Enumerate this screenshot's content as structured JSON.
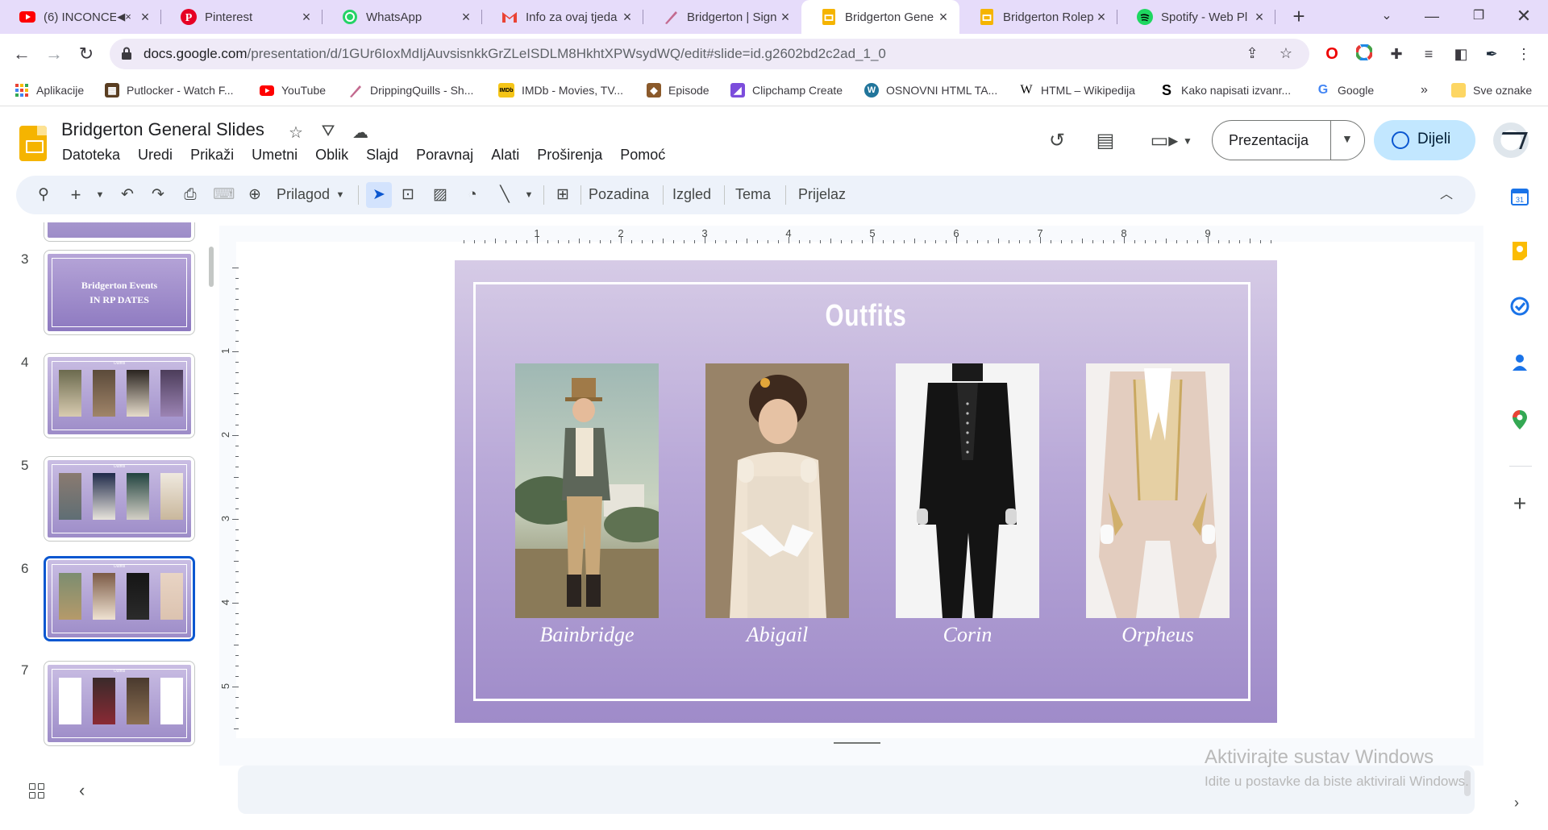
{
  "browser": {
    "tabs": [
      {
        "label": "(6) INCONCE",
        "icon": "youtube-icon",
        "color": "#ff0000",
        "muted_icon": true
      },
      {
        "label": "Pinterest",
        "icon": "pinterest-icon",
        "color": "#e60023"
      },
      {
        "label": "WhatsApp",
        "icon": "whatsapp-icon",
        "color": "#25d366"
      },
      {
        "label": "Info za ovaj tjeda",
        "icon": "gmail-icon",
        "color": "#ea4335"
      },
      {
        "label": "Bridgerton | Sign",
        "icon": "quill-icon",
        "color": "#c36a8f"
      },
      {
        "label": "Bridgerton Gene",
        "icon": "slides-icon",
        "color": "#f5b400",
        "active": true
      },
      {
        "label": "Bridgerton Rolep",
        "icon": "slides-icon",
        "color": "#f5b400"
      },
      {
        "label": "Spotify - Web Pl",
        "icon": "spotify-icon",
        "color": "#1ed760"
      }
    ],
    "url_main": "docs.google.com",
    "url_rest": "/presentation/d/1GUr6IoxMdIjAuvsisnkkGrZLeISDLM8HkhtXPWsydWQ/edit#slide=id.g2602bd2c2ad_1_0",
    "bookmarks": [
      {
        "label": "Aplikacije",
        "icon": "apps-grid-icon"
      },
      {
        "label": "Putlocker - Watch F...",
        "icon": "putlocker-icon"
      },
      {
        "label": "YouTube",
        "icon": "youtube-icon"
      },
      {
        "label": "DrippingQuills - Sh...",
        "icon": "quill-icon"
      },
      {
        "label": "IMDb - Movies, TV...",
        "icon": "imdb-icon"
      },
      {
        "label": "Episode",
        "icon": "episode-icon"
      },
      {
        "label": "Clipchamp Create",
        "icon": "clipchamp-icon"
      },
      {
        "label": "OSNOVNI HTML TA...",
        "icon": "wordpress-icon"
      },
      {
        "label": "HTML – Wikipedija",
        "icon": "wikipedia-icon"
      },
      {
        "label": "Kako napisati izvanr...",
        "icon": "s-icon"
      },
      {
        "label": "Google",
        "icon": "google-icon"
      }
    ],
    "bookmarks_more": "»",
    "other_bookmarks": "Sve oznake"
  },
  "doc": {
    "title": "Bridgerton General Slides",
    "menu": [
      "Datoteka",
      "Uredi",
      "Prikaži",
      "Umetni",
      "Oblik",
      "Slajd",
      "Poravnaj",
      "Alati",
      "Proširenja",
      "Pomoć"
    ],
    "present_label": "Prezentacija",
    "share_label": "Dijeli"
  },
  "toolbar": {
    "zoom_label": "Prilagod",
    "background_label": "Pozadina",
    "layout_label": "Izgled",
    "theme_label": "Tema",
    "transition_label": "Prijelaz"
  },
  "filmstrip": [
    {
      "num": "3",
      "kind": "title",
      "line1": "Bridgerton Events",
      "line2": "IN RP DATES"
    },
    {
      "num": "4",
      "kind": "outfits",
      "title": "Outfits"
    },
    {
      "num": "5",
      "kind": "outfits",
      "title": "Outfits"
    },
    {
      "num": "6",
      "kind": "outfits",
      "title": "Outfits",
      "active": true
    },
    {
      "num": "7",
      "kind": "outfits",
      "title": "Outfits"
    }
  ],
  "ruler": {
    "h_labels": [
      "1",
      "2",
      "3",
      "4",
      "5",
      "6",
      "7",
      "8",
      "9"
    ],
    "v_labels": [
      "1",
      "2",
      "3",
      "4",
      "5"
    ]
  },
  "slide": {
    "title": "Outfits",
    "outfits": [
      {
        "name": "Bainbridge",
        "image": "regency-gentleman-portrait"
      },
      {
        "name": "Abigail",
        "image": "regency-lady-gown"
      },
      {
        "name": "Corin",
        "image": "black-tailcoat-suit"
      },
      {
        "name": "Orpheus",
        "image": "cream-embroidered-coat"
      }
    ]
  },
  "watermark": {
    "line1": "Aktivirajte sustav Windows",
    "line2": "Idite u postavke da biste aktivirali Windows."
  },
  "colors": {
    "tabstrip": "#e6dcfa",
    "slide_top": "#d6cbe6",
    "slide_bottom": "#9f8bc9",
    "accent_blue": "#0b57d0",
    "share_bg": "#c2e7ff"
  }
}
